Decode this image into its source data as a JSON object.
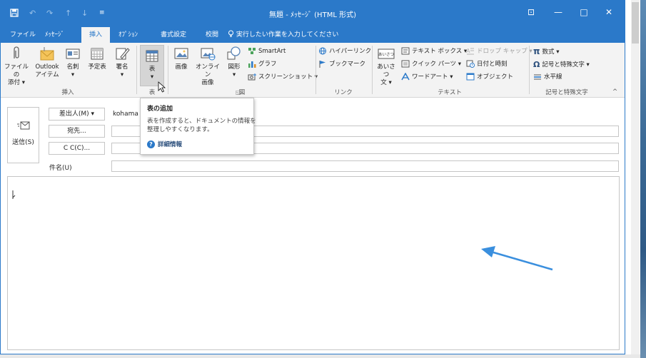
{
  "window": {
    "title": "無題 - ﾒｯｾｰｼﾞ (HTML 形式)",
    "accent": "#2b79c9",
    "buttons": {
      "minimize": "—",
      "maximize": "□",
      "close": "✕",
      "ribbon_display": "⊡"
    }
  },
  "qat": {
    "save": "🖫",
    "undo": "↶",
    "redo": "↷",
    "up": "↑",
    "down": "↓",
    "customize": "≡"
  },
  "tabs": [
    {
      "label": "ファイル"
    },
    {
      "label": "ﾒｯｾｰｼﾞ"
    },
    {
      "label": "挿入",
      "active": true
    },
    {
      "label": "ｵﾌﾟｼｮﾝ"
    },
    {
      "label": "書式設定"
    },
    {
      "label": "校閲"
    }
  ],
  "tell_me": {
    "icon": "lightbulb-icon",
    "placeholder": "実行したい作業を入力してください"
  },
  "ribbon": {
    "groups": {
      "insert": "挿入",
      "table": "表",
      "illustrations": "図",
      "links": "リンク",
      "text": "テキスト",
      "symbols": "記号と特殊文字"
    },
    "attach_file": [
      "ファイルの",
      "添付 ▾"
    ],
    "outlook_item": [
      "Outlook",
      "アイテム"
    ],
    "business_card": [
      "名刺",
      "▾"
    ],
    "calendar": [
      "予定表",
      ""
    ],
    "signature": [
      "署名",
      "▾"
    ],
    "table": [
      "表",
      "▾"
    ],
    "picture": [
      "画像",
      ""
    ],
    "online_picture": [
      "オンライン",
      "画像"
    ],
    "shapes": [
      "図形",
      "▾"
    ],
    "smartart": "SmartArt",
    "chart": "グラフ",
    "screenshot": "スクリーンショット ▾",
    "hyperlink": "ハイパーリンク",
    "bookmark": "ブックマーク",
    "greeting": [
      "あいさつ",
      "文 ▾"
    ],
    "greeting_icon_text": "あいさつ",
    "text_box": "テキスト ボックス ▾",
    "quick_parts": "クイック パーツ ▾",
    "wordart": "ワードアート ▾",
    "drop_cap": "ドロップ キャップ ▾",
    "date_time": "日付と時刻",
    "object": "オブジェクト",
    "equation": "数式 ▾",
    "symbol": "記号と特殊文字 ▾",
    "horizontal_line": "水平線",
    "equation_glyph": "π",
    "symbol_glyph": "Ω",
    "collapse": "^"
  },
  "compose": {
    "send": "送信(S)",
    "from_button": "差出人(M) ▾",
    "from_value": "kohama",
    "to_button": "宛先...",
    "cc_button": "C C(C)...",
    "subject_label": "件名(U)"
  },
  "tooltip": {
    "title": "表の追加",
    "body_line1": "表を作成すると、ドキュメントの情報を",
    "body_line2": "整理しやすくなります。",
    "link": "詳細情報",
    "help_glyph": "?"
  }
}
